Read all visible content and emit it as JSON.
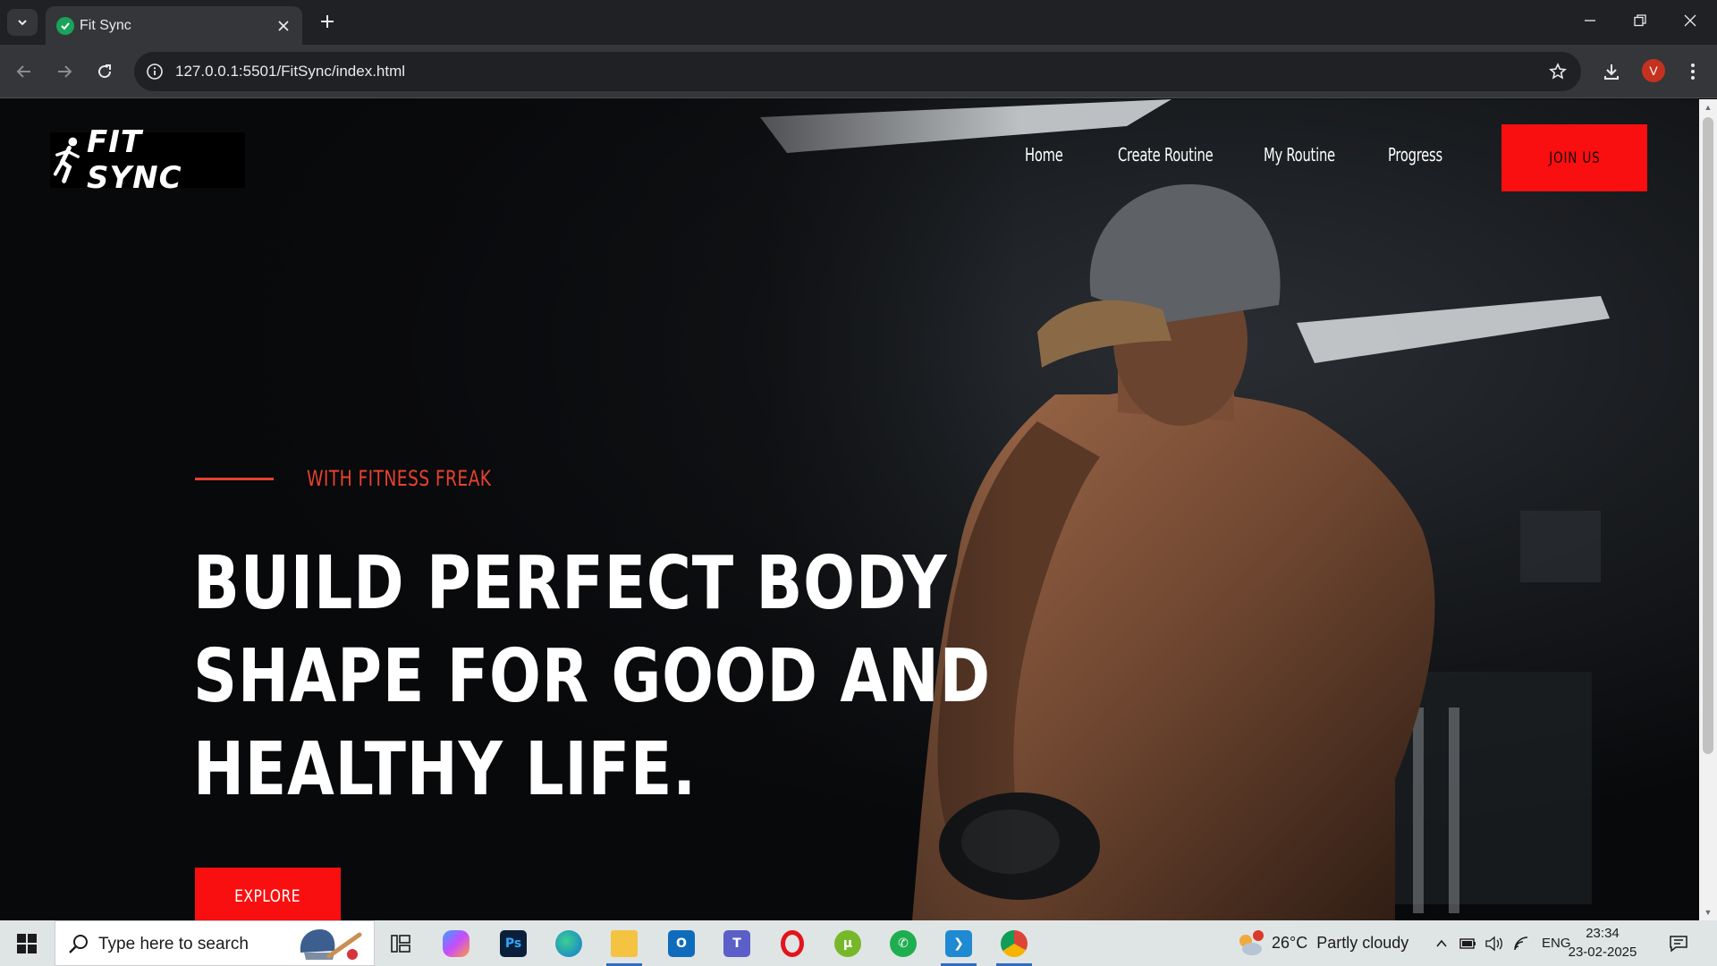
{
  "browser": {
    "tab_title": "Fit Sync",
    "url": "127.0.0.1:5501/FitSync/index.html",
    "profile_initial": "V"
  },
  "site": {
    "logo_text": "FIT SYNC",
    "nav": [
      "Home",
      "Create Routine",
      "My Routine",
      "Progress"
    ],
    "join_label": "JOIN US",
    "tagline": "WITH FITNESS FREAK",
    "headline": [
      "BUILD PERFECT BODY",
      "SHAPE FOR GOOD AND",
      "HEALTHY LIFE."
    ],
    "explore_label": "EXPLORE",
    "accent_color": "#f90f10"
  },
  "taskbar": {
    "search_placeholder": "Type here to search",
    "apps": [
      "task-view",
      "copilot",
      "photoshop",
      "edge",
      "file-explorer",
      "outlook",
      "teams",
      "opera",
      "utorrent",
      "whatsapp",
      "vscode",
      "chrome"
    ],
    "weather": {
      "temp": "26°C",
      "condition": "Partly cloudy",
      "badge": "1"
    },
    "language": "ENG",
    "time": "23:34",
    "date": "23-02-2025"
  }
}
